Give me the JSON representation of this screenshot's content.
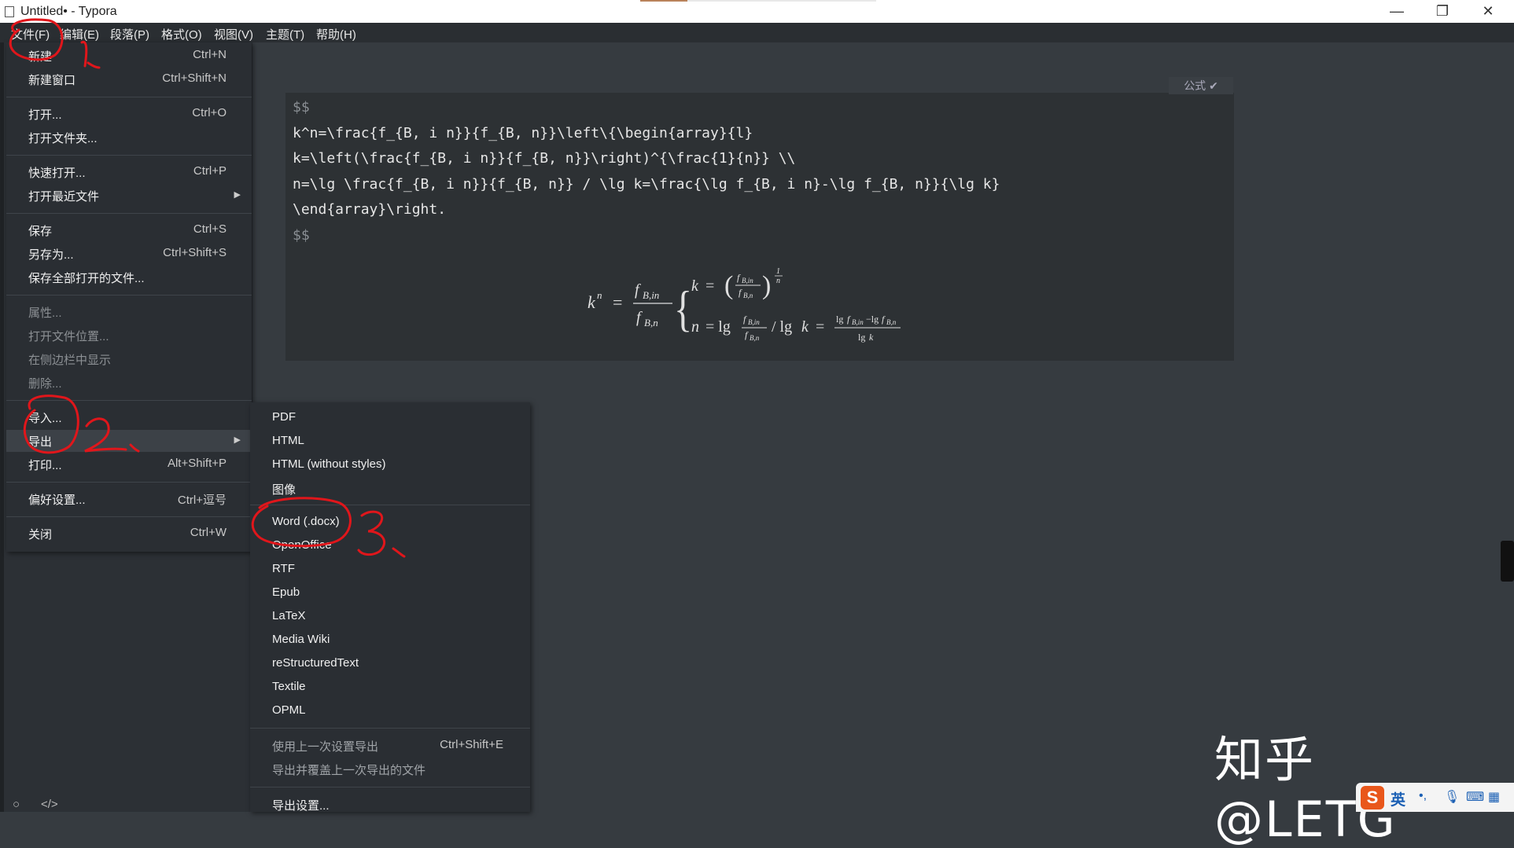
{
  "window": {
    "title": "Untitled• - Typora",
    "minimize": "—",
    "restore": "❐",
    "close": "✕"
  },
  "menubar": [
    "文件(F)",
    "编辑(E)",
    "段落(P)",
    "格式(O)",
    "视图(V)",
    "主题(T)",
    "帮助(H)"
  ],
  "file_menu": [
    {
      "label": "新建",
      "shortcut": "Ctrl+N"
    },
    {
      "label": "新建窗口",
      "shortcut": "Ctrl+Shift+N"
    },
    {
      "label": "打开...",
      "shortcut": "Ctrl+O"
    },
    {
      "label": "打开文件夹...",
      "shortcut": ""
    },
    {
      "label": "快速打开...",
      "shortcut": "Ctrl+P"
    },
    {
      "label": "打开最近文件",
      "shortcut": "",
      "submenu": true
    },
    {
      "label": "保存",
      "shortcut": "Ctrl+S"
    },
    {
      "label": "另存为...",
      "shortcut": "Ctrl+Shift+S"
    },
    {
      "label": "保存全部打开的文件...",
      "shortcut": ""
    },
    {
      "label": "属性...",
      "shortcut": "",
      "disabled": true
    },
    {
      "label": "打开文件位置...",
      "shortcut": "",
      "disabled": true
    },
    {
      "label": "在侧边栏中显示",
      "shortcut": "",
      "disabled": true
    },
    {
      "label": "删除...",
      "shortcut": "",
      "disabled": true
    },
    {
      "label": "导入...",
      "shortcut": ""
    },
    {
      "label": "导出",
      "shortcut": "",
      "submenu": true,
      "active": true
    },
    {
      "label": "打印...",
      "shortcut": "Alt+Shift+P"
    },
    {
      "label": "偏好设置...",
      "shortcut": "Ctrl+逗号"
    },
    {
      "label": "关闭",
      "shortcut": "Ctrl+W"
    }
  ],
  "export_menu": [
    {
      "label": "PDF"
    },
    {
      "label": "HTML"
    },
    {
      "label": "HTML (without styles)"
    },
    {
      "label": "图像"
    },
    {
      "label": "Word (.docx)"
    },
    {
      "label": "OpenOffice"
    },
    {
      "label": "RTF"
    },
    {
      "label": "Epub"
    },
    {
      "label": "LaTeX"
    },
    {
      "label": "Media Wiki"
    },
    {
      "label": "reStructuredText"
    },
    {
      "label": "Textile"
    },
    {
      "label": "OPML"
    },
    {
      "label": "使用上一次设置导出",
      "shortcut": "Ctrl+Shift+E",
      "disabled": true
    },
    {
      "label": "导出并覆盖上一次导出的文件",
      "disabled": true
    },
    {
      "label": "导出设置..."
    }
  ],
  "math_block": {
    "tag": "公式 ✔",
    "delimiter": "$$",
    "source_lines": [
      "k^n=\\frac{f_{B, i n}}{f_{B, n}}\\left\\{\\begin{array}{l}",
      "k=\\left(\\frac{f_{B, i n}}{f_{B, n}}\\right)^{\\frac{1}{n}} \\\\",
      "n=\\lg \\frac{f_{B, i n}}{f_{B, n}} / \\lg k=\\frac{\\lg f_{B, i n}-\\lg f_{B, n}}{\\lg k}",
      "\\end{array}\\right."
    ]
  },
  "watermark": "知乎 @LETG",
  "ime": {
    "logo": "S",
    "lang": "英"
  },
  "annotations": [
    "1、",
    "2、",
    "3、"
  ]
}
